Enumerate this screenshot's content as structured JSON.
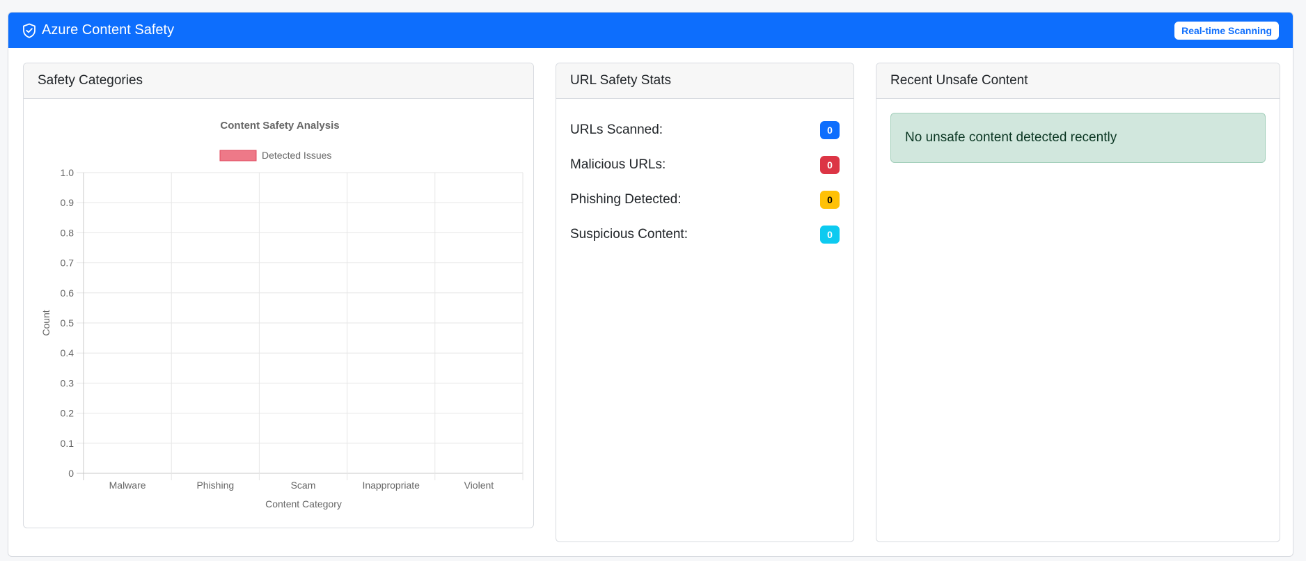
{
  "app": {
    "title": "Azure Content Safety",
    "badge": "Real-time Scanning",
    "shield_icon": "shield-check-icon"
  },
  "colors": {
    "primary": "#0d6efd",
    "danger": "#dc3545",
    "warning": "#ffc107",
    "info": "#0dcaf0",
    "success_bg": "#d1e7dd",
    "bar_fill": "#f07a88"
  },
  "safety_categories": {
    "header": "Safety Categories"
  },
  "url_stats": {
    "header": "URL Safety Stats",
    "items": [
      {
        "label": "URLs Scanned:",
        "value": "0",
        "color": "#0d6efd",
        "text_color": "#ffffff"
      },
      {
        "label": "Malicious URLs:",
        "value": "0",
        "color": "#dc3545",
        "text_color": "#ffffff"
      },
      {
        "label": "Phishing Detected:",
        "value": "0",
        "color": "#ffc107",
        "text_color": "#000000"
      },
      {
        "label": "Suspicious Content:",
        "value": "0",
        "color": "#0dcaf0",
        "text_color": "#ffffff"
      }
    ]
  },
  "recent": {
    "header": "Recent Unsafe Content",
    "empty_message": "No unsafe content detected recently"
  },
  "chart_data": {
    "type": "bar",
    "title": "Content Safety Analysis",
    "categories": [
      "Malware",
      "Phishing",
      "Scam",
      "Inappropriate",
      "Violent"
    ],
    "series": [
      {
        "name": "Detected Issues",
        "values": [
          0,
          0,
          0,
          0,
          0
        ]
      }
    ],
    "xlabel": "Content Category",
    "ylabel": "Count",
    "ylim": [
      0,
      1.0
    ],
    "yticks": [
      "0",
      "0.1",
      "0.2",
      "0.3",
      "0.4",
      "0.5",
      "0.6",
      "0.7",
      "0.8",
      "0.9",
      "1.0"
    ],
    "legend": "top",
    "grid": true
  }
}
